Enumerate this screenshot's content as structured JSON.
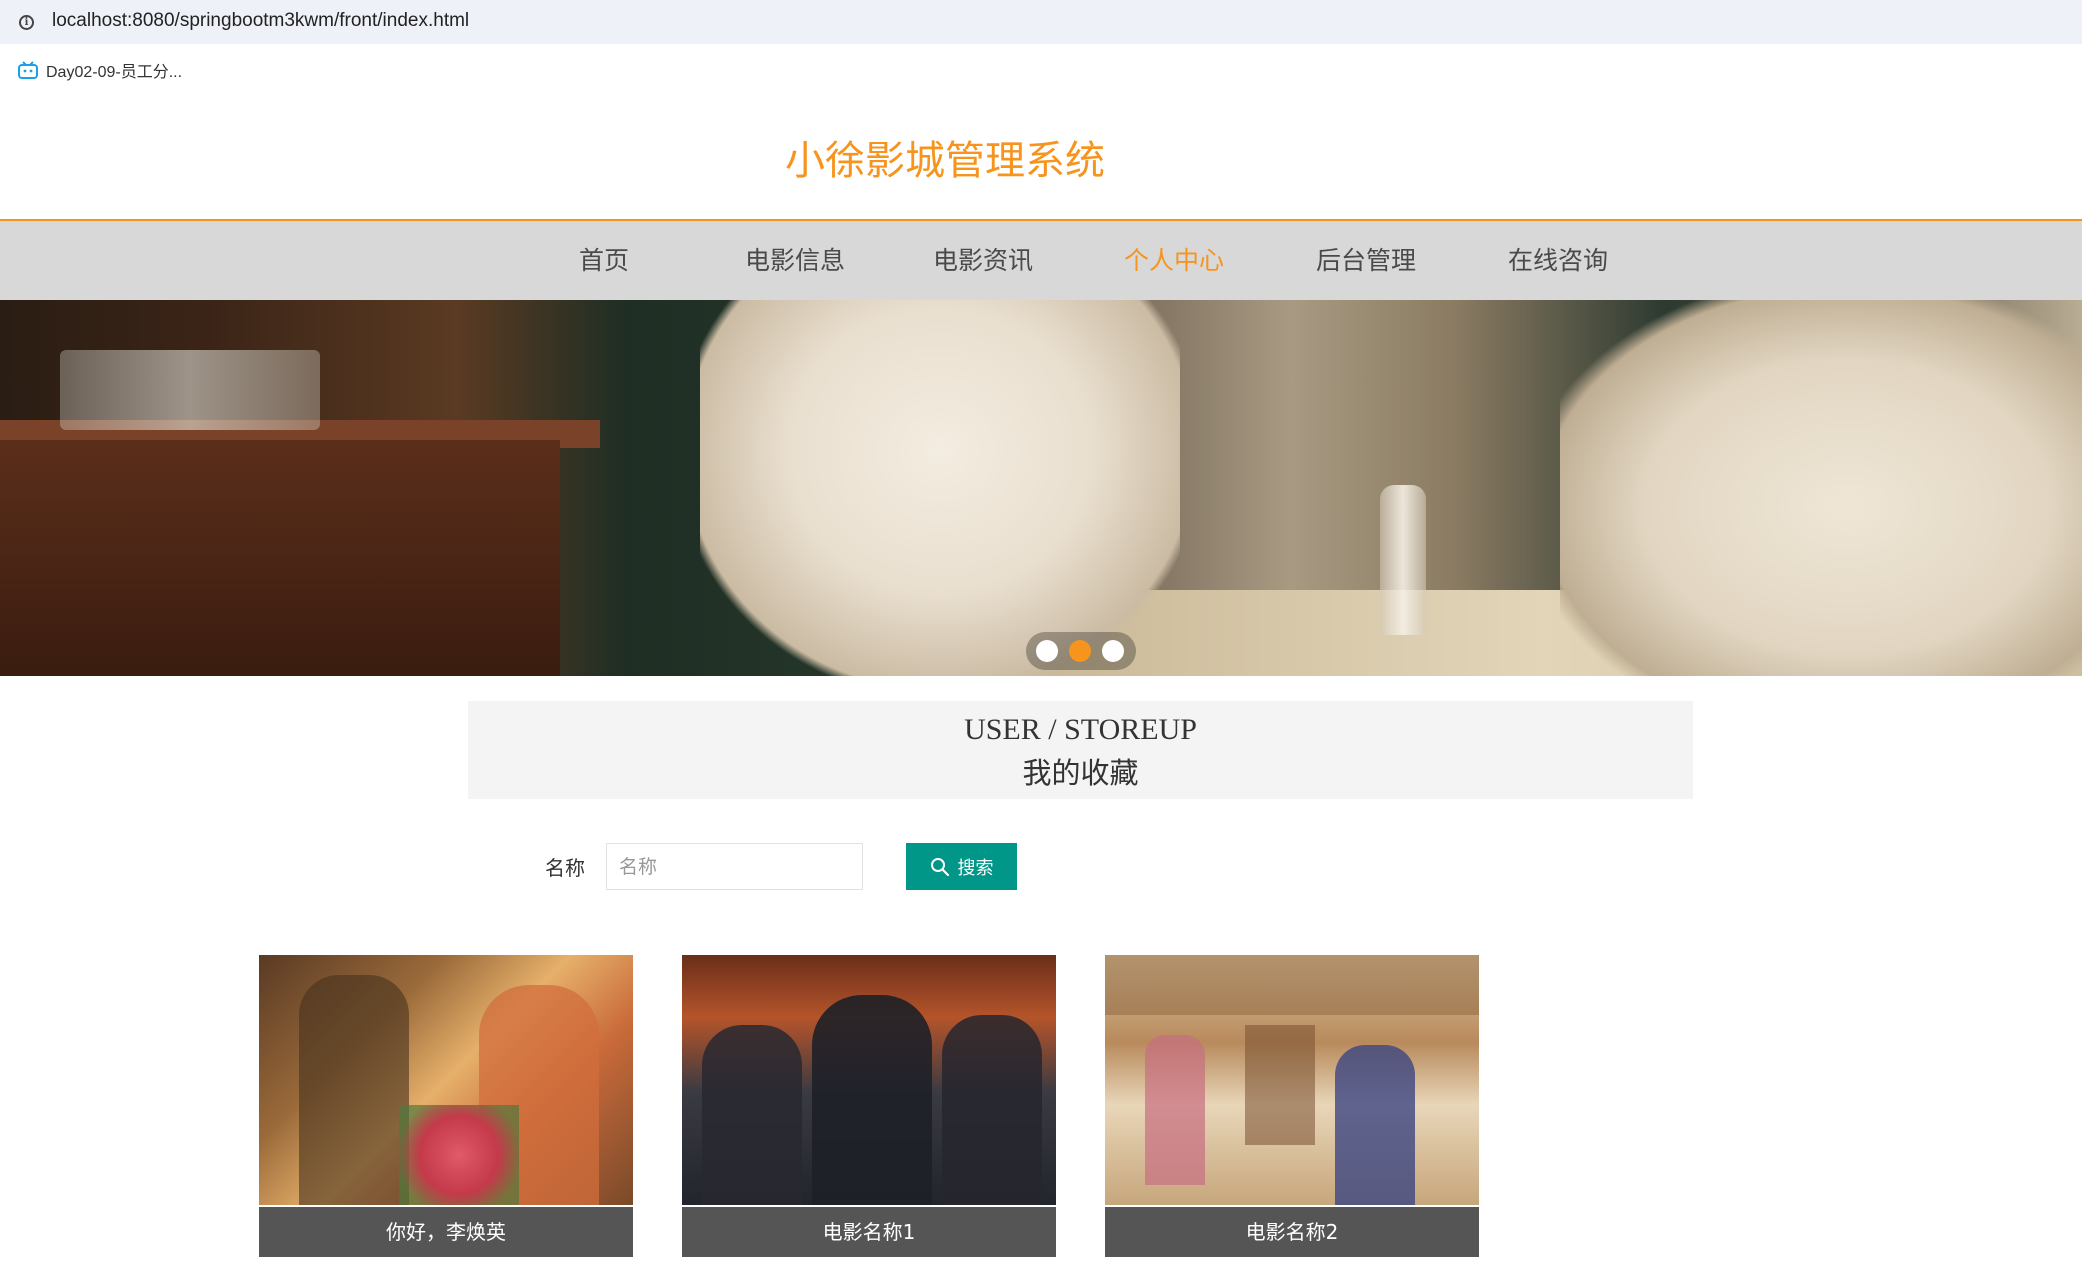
{
  "browser": {
    "url": "localhost:8080/springbootm3kwm/front/index.html",
    "bookmark_label": "Day02-09-员工分..."
  },
  "site": {
    "title": "小徐影城管理系统"
  },
  "nav": {
    "items": [
      {
        "label": "首页",
        "active": false
      },
      {
        "label": "电影信息",
        "active": false
      },
      {
        "label": "电影资讯",
        "active": false
      },
      {
        "label": "个人中心",
        "active": true
      },
      {
        "label": "后台管理",
        "active": false
      },
      {
        "label": "在线咨询",
        "active": false
      }
    ]
  },
  "carousel": {
    "slide_count": 3,
    "active_index": 1
  },
  "section": {
    "title_en": "USER / STOREUP",
    "title_cn": "我的收藏"
  },
  "search": {
    "label": "名称",
    "placeholder": "名称",
    "value": "",
    "button_label": "搜索"
  },
  "cards": [
    {
      "title": "你好，李焕英"
    },
    {
      "title": "电影名称1"
    },
    {
      "title": "电影名称2"
    }
  ],
  "colors": {
    "accent": "#f7941d",
    "nav_bg": "#d8d8d8",
    "button": "#009688",
    "card_label_bg": "#555555"
  }
}
